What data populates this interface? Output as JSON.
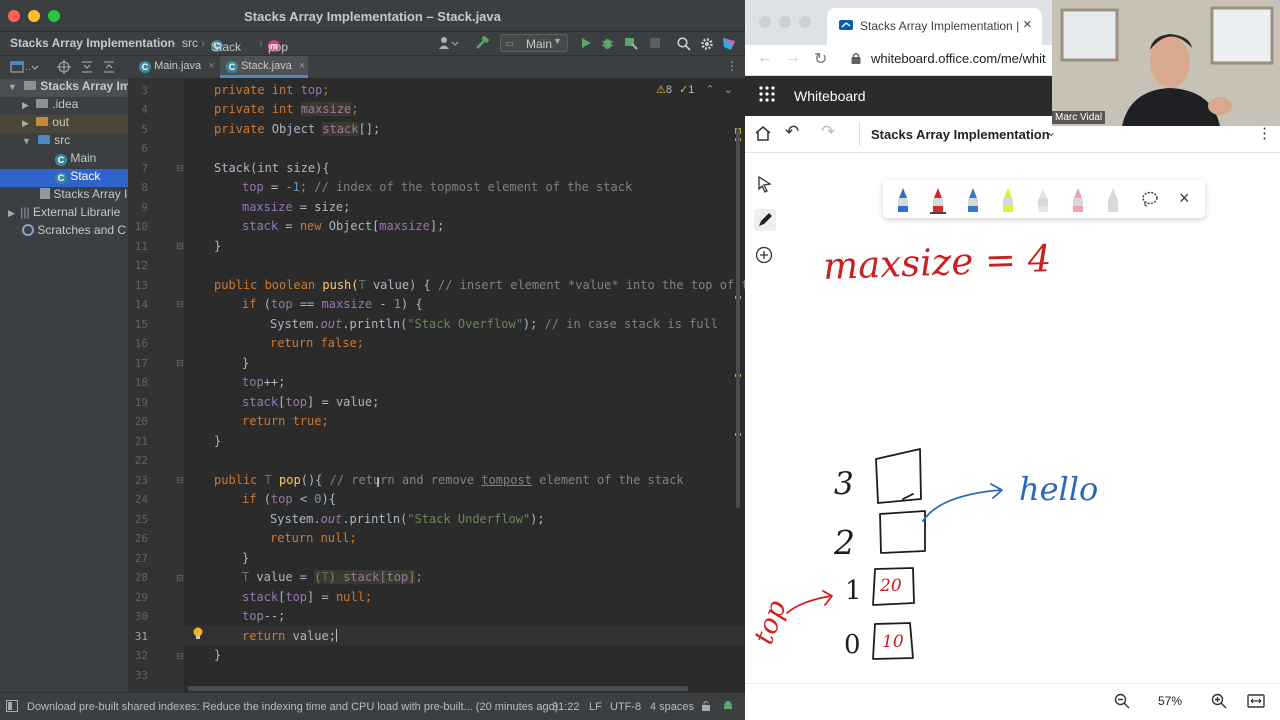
{
  "ide": {
    "window_title": "Stacks Array Implementation – Stack.java",
    "breadcrumb": {
      "project": "Stacks Array Implementation",
      "folder": "src",
      "class": "Stack",
      "method": "pop"
    },
    "run_config": "Main",
    "tabs": [
      {
        "label": "Main.java"
      },
      {
        "label": "Stack.java"
      }
    ],
    "inspection": {
      "warnings": "8",
      "weak_warnings": "1"
    },
    "tree": {
      "root": "Stacks Array Im",
      "idea": ".idea",
      "out": "out",
      "src": "src",
      "main": "Main",
      "stack": "Stack",
      "iml": "Stacks Array I",
      "external": "External Librarie",
      "scratches": "Scratches and C"
    },
    "line_numbers": [
      "3",
      "4",
      "5",
      "6",
      "7",
      "8",
      "9",
      "10",
      "11",
      "12",
      "13",
      "14",
      "15",
      "16",
      "17",
      "18",
      "19",
      "20",
      "21",
      "22",
      "23",
      "24",
      "25",
      "26",
      "27",
      "28",
      "29",
      "30",
      "31",
      "32",
      "33"
    ],
    "code": {
      "l3a": "private int ",
      "l3b": "top",
      "l3c": ";",
      "l4a": "private int ",
      "l4b": "maxsize",
      "l4c": ";",
      "l5a": "private ",
      "l5b": "Object ",
      "l5c": "stack",
      "l5d": "[];",
      "l7": "Stack(int size){",
      "l8a": "top",
      "l8b": " = ",
      "l8c": "-1",
      "l8d": "; ",
      "l8e": "// index of the topmost element of the stack",
      "l9a": "maxsize",
      "l9b": " = size;",
      "l10a": "stack",
      "l10b": " = ",
      "l10c": "new ",
      "l10d": "Object[",
      "l10e": "maxsize",
      "l10f": "];",
      "l12": "",
      "l13a": "public boolean ",
      "l13b": "push(",
      "l13c": "T",
      "l13d": " value) { ",
      "l13e": "// insert element *value* into the top of the",
      "l14a": "if ",
      "l14b": "(",
      "l14c": "top",
      "l14d": " == ",
      "l14e": "maxsize",
      "l14f": " - ",
      "l14g": "1",
      "l14h": ") {",
      "l15a": "System.",
      "l15b": "out",
      "l15c": ".println(",
      "l15d": "\"Stack Overflow\"",
      "l15e": "); ",
      "l15f": "// in case stack is full",
      "l16a": "return false",
      "l16b": ";",
      "l17": "}",
      "l18a": "top",
      "l18b": "++;",
      "l19a": "stack",
      "l19b": "[",
      "l19c": "top",
      "l19d": "] = value;",
      "l20a": "return true",
      "l20b": ";",
      "l21": "}",
      "l23a": "public ",
      "l23b": "T ",
      "l23c": "pop",
      "l23d": "(){ ",
      "l23e": "// return and remove ",
      "l23f": "tompost",
      "l23g": " element of the stack",
      "l24a": "if ",
      "l24b": "(",
      "l24c": "top",
      "l24d": " < ",
      "l24e": "0",
      "l24f": "){",
      "l25a": "System.",
      "l25b": "out",
      "l25c": ".println(",
      "l25d": "\"Stack Underflow\"",
      "l25e": ");",
      "l26a": "return null",
      "l26b": ";",
      "l27": "}",
      "l28a": "T",
      "l28b": " value = ",
      "l28c": "(",
      "l28d": "T",
      "l28e": ") ",
      "l28f": "stack",
      "l28g": "[",
      "l28h": "top",
      "l28i": "]",
      "l28j": ";",
      "l29a": "stack",
      "l29b": "[",
      "l29c": "top",
      "l29d": "] = ",
      "l29e": "null",
      "l29f": ";",
      "l30a": "top",
      "l30b": "--;",
      "l31a": "return ",
      "l31b": "value;",
      "l32": "}"
    },
    "status": {
      "message": "Download pre-built shared indexes: Reduce the indexing time and CPU load with pre-built... (20 minutes ago)",
      "position": "31:22",
      "line_sep": "LF",
      "encoding": "UTF-8",
      "indent": "4 spaces"
    }
  },
  "browser": {
    "tab_title": "Stacks Array Implementation |",
    "url": "whiteboard.office.com/me/whit",
    "app_name": "Whiteboard",
    "board_title": "Stacks Array Implementation",
    "zoom": "57%",
    "webcam_name": "Marc Vidal",
    "pen_colors": [
      "#2f6fc5",
      "#d02a2a",
      "#3a7ac8",
      "#e6ec3a",
      "#e8e8e0",
      "#f3a1ad",
      "#d8dcd3"
    ]
  },
  "whiteboard": {
    "heading": "maxsize = 4",
    "index_labels": [
      "3",
      "2",
      "1",
      "0"
    ],
    "cell_values": [
      "20",
      "10"
    ],
    "arrow_label": "hello",
    "pointer_label": "top"
  }
}
